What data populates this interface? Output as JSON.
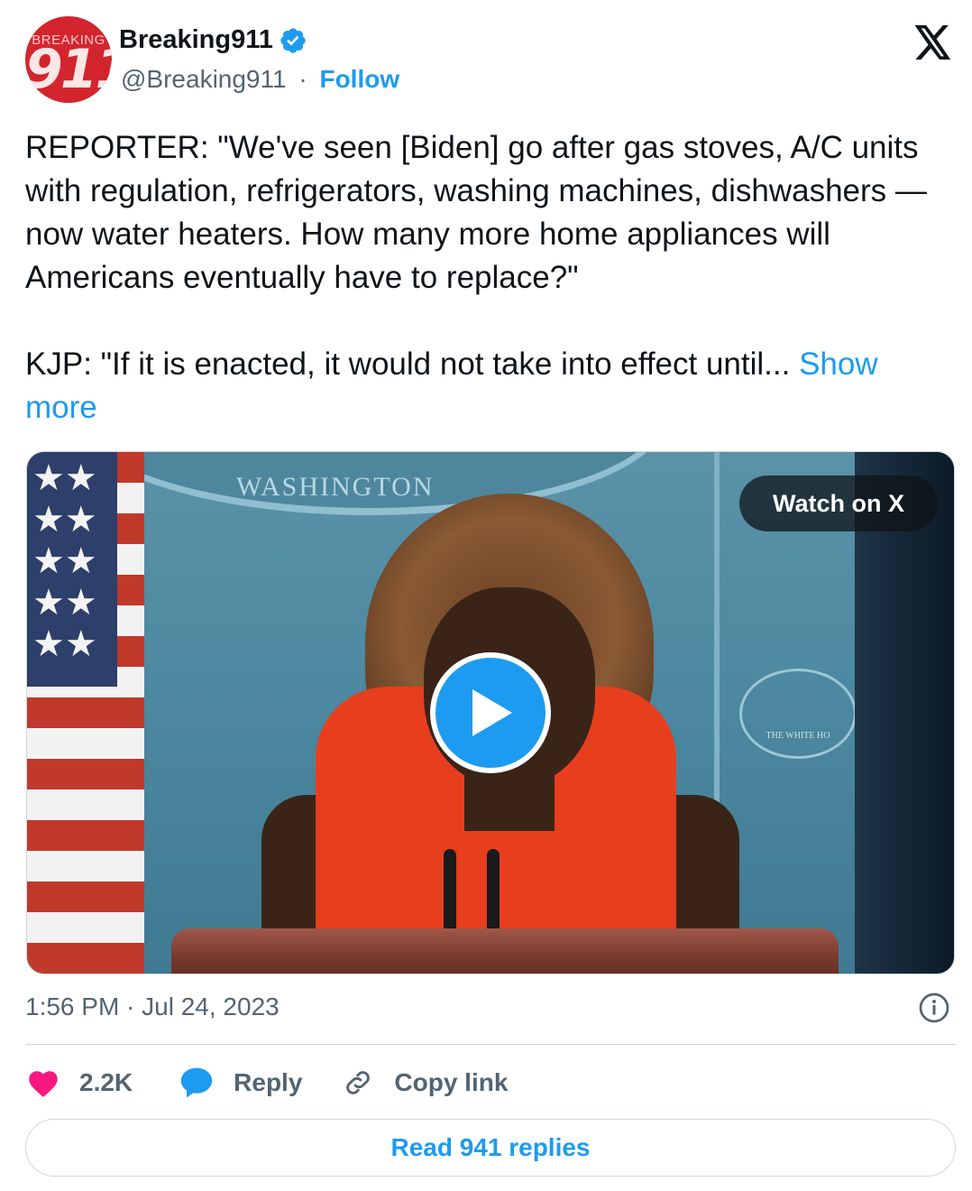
{
  "author": {
    "display_name": "Breaking911",
    "handle": "@Breaking911",
    "separator": "·",
    "follow_label": "Follow",
    "avatar_top_text": "BREAKING",
    "avatar_number": "911",
    "verified": true
  },
  "tweet": {
    "text": "REPORTER: \"We've seen [Biden] go after gas stoves, A/C units with regulation, refrigerators, washing machines, dishwashers — now water heaters. How many more home appliances will Americans eventually have to replace?\"\n\nKJP: \"If it is enacted, it would not take into effect until... ",
    "show_more_label": "Show more"
  },
  "media": {
    "watch_label": "Watch on X",
    "scene_text": "WASHINGTON",
    "logo_text": "THE WHITE HO"
  },
  "meta": {
    "timestamp": "1:56 PM · Jul 24, 2023"
  },
  "actions": {
    "likes_count": "2.2K",
    "reply_label": "Reply",
    "copy_link_label": "Copy link"
  },
  "footer": {
    "read_replies_label": "Read 941 replies"
  },
  "colors": {
    "accent": "#1d9bf0",
    "like": "#f91880",
    "text_primary": "#0f1419",
    "text_secondary": "#536471",
    "border": "#cfd9de",
    "avatar_bg": "#d3252e"
  }
}
